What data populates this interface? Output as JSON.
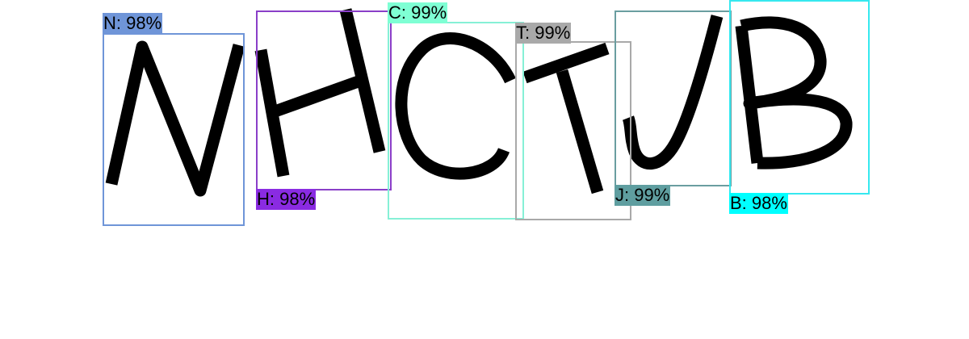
{
  "image": {
    "background": "#ffffff",
    "ink_color": "#000000",
    "glyphs": [
      "N",
      "H",
      "C",
      "T",
      "J",
      "B"
    ]
  },
  "detections": [
    {
      "letter": "N",
      "confidence": "98%",
      "label": "N: 98%",
      "color": "#6f95d8",
      "label_bg": "#6f95d8"
    },
    {
      "letter": "H",
      "confidence": "98%",
      "label": "H: 98%",
      "color": "#8a3fc8",
      "label_bg": "#8a2be2"
    },
    {
      "letter": "C",
      "confidence": "99%",
      "label": "C: 99%",
      "color": "#86f0d6",
      "label_bg": "#7fffd4"
    },
    {
      "letter": "T",
      "confidence": "99%",
      "label": "T: 99%",
      "color": "#a9a9a9",
      "label_bg": "#a9a9a9"
    },
    {
      "letter": "J",
      "confidence": "99%",
      "label": "J: 99%",
      "color": "#6a9ea0",
      "label_bg": "#5f9ea0"
    },
    {
      "letter": "B",
      "confidence": "98%",
      "label": "B: 98%",
      "color": "#36e8ef",
      "label_bg": "#00ffff"
    }
  ]
}
